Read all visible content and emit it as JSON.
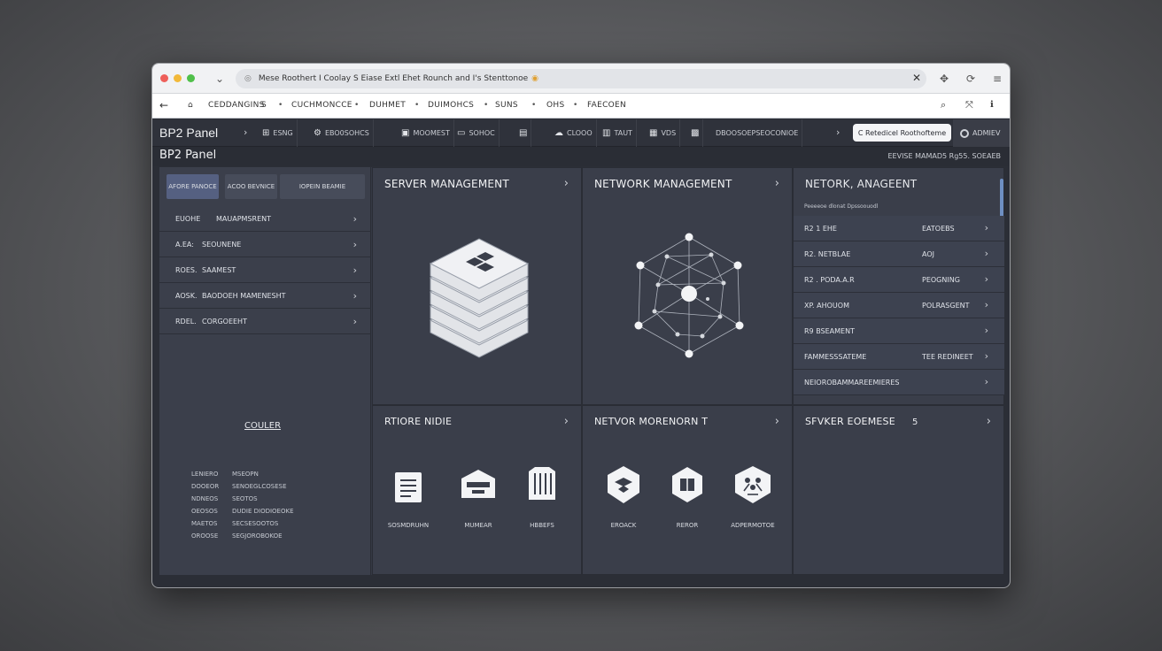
{
  "browser": {
    "address": "Mese Roothert I Coolay S Eiase Extl Ehet Rounch and I's Stenttonoe",
    "close_glyph": "✕"
  },
  "toolbar": {
    "items": [
      "CEDDANGINS",
      "S",
      "CUCHMONCCE",
      "DUHMET",
      "DUIMOHCS",
      "SUNS",
      "OHS",
      "FAECOEN"
    ]
  },
  "appnav": {
    "brand": "BP2 Panel",
    "items": [
      {
        "label": "ESNG",
        "icon": "grid-icon"
      },
      {
        "label": "EBO0SOHCS",
        "icon": "settings-icon"
      },
      {
        "label": "MOOMEST",
        "icon": "monitor-icon"
      },
      {
        "label": "SOHOC",
        "icon": "folder-icon"
      },
      {
        "label": "",
        "icon": "server-icon"
      },
      {
        "label": "CLOOO",
        "icon": "cloud-icon"
      },
      {
        "label": "TAUT",
        "icon": "chart-icon"
      },
      {
        "label": "VDS",
        "icon": "database-icon"
      },
      {
        "label": "",
        "icon": "cpu-icon"
      },
      {
        "label": "DBOOSOEPSEOCONIOE",
        "icon": ""
      }
    ],
    "pill_label": "C Retedicel Roothofteme",
    "user_label": "ADMIEV"
  },
  "titlebar": {
    "title": "BP2 Panel",
    "right": "EEVISE MAMAD5 Rg55. SOEAEB"
  },
  "sidebar": {
    "tabs": [
      "AFORE PANOCE",
      "ACOO BEVNICE",
      "IOPEIN BEAMIE"
    ],
    "rows": [
      {
        "prefix": "EUOHE",
        "label": "MAUAPMSRENT"
      },
      {
        "prefix": "A.EA:",
        "label": "SEOUNENE"
      },
      {
        "prefix": "ROES.",
        "label": "SAAMEST"
      },
      {
        "prefix": "AOSK.",
        "label": "BAODOEH MAMENESHT"
      },
      {
        "prefix": "RDEL.",
        "label": "CORGOEEHT"
      }
    ],
    "counter_title": "COULER",
    "counter_rows": [
      {
        "k": "LENIERO",
        "v": "MSEOPN"
      },
      {
        "k": "DOOEOR",
        "v": "SENOEGLCOSESE"
      },
      {
        "k": "NDNEOS",
        "v": "SEOTOS"
      },
      {
        "k": "OEOSOS",
        "v": "DUDIE DIODIOEOKE"
      },
      {
        "k": "MAETOS",
        "v": "SECSESOOTOS"
      },
      {
        "k": "OROOSE",
        "v": "SEGJOROBOKOE"
      }
    ]
  },
  "panels": {
    "server": {
      "title": "SERVER MANAGEMENT",
      "icon": "server-stack-icon"
    },
    "network": {
      "title": "NETWORK MANAGEMENT",
      "icon": "network-graph-icon"
    },
    "network_right": {
      "title": "NETORK, ANAGEENT",
      "subtitle": "Peeeeoe dlonat Dpssoouodl",
      "rows": [
        {
          "a": "R2 1 EHE",
          "b": "EATOEBS"
        },
        {
          "a": "R2. NETBLAE",
          "b": "AOJ"
        },
        {
          "a": "R2 . PODA.A.R",
          "b": "PEOGNING"
        },
        {
          "a": "XP. AHOUOM",
          "b": "POLRASGENT"
        },
        {
          "a": "R9 BSEAMENT",
          "b": ""
        },
        {
          "a": "FAMMESSSATEME",
          "b": "TEE REDINEET"
        },
        {
          "a": "NEIOROBAMMAREEMIERES",
          "b": ""
        }
      ]
    },
    "storage": {
      "title": "RTIORE NIDIE",
      "tiles": [
        {
          "label": "SOSMDRUHN",
          "icon": "document-icon"
        },
        {
          "label": "MUMEAR",
          "icon": "inbox-icon"
        },
        {
          "label": "HBBEFS",
          "icon": "archive-icon"
        }
      ]
    },
    "netmon": {
      "title": "NETVOR MORENORN T",
      "tiles": [
        {
          "label": "EROACK",
          "icon": "shield-icon"
        },
        {
          "label": "REROR",
          "icon": "book-icon"
        },
        {
          "label": "ADPERMOTOE",
          "icon": "people-icon"
        }
      ]
    },
    "server_expense": {
      "title": "SFVKER EOEMESE",
      "badge": "5"
    }
  },
  "colors": {
    "accent": "#556081",
    "scrollbar": "#6e8fc2",
    "panel_bg": "#3a3e4a"
  }
}
